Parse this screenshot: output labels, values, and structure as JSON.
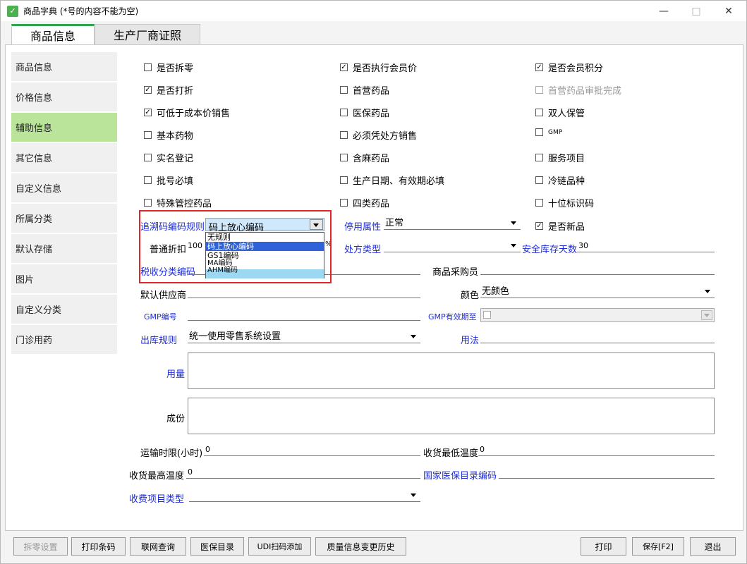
{
  "window": {
    "title": "商品字典 (*号的内容不能为空)",
    "minimize": "—",
    "maximize": "□",
    "close": "✕"
  },
  "tabs": [
    "商品信息",
    "生产厂商证照"
  ],
  "nav": [
    "商品信息",
    "价格信息",
    "辅助信息",
    "其它信息",
    "自定义信息",
    "所属分类",
    "默认存储",
    "图片",
    "自定义分类",
    "门诊用药"
  ],
  "checkboxes": {
    "col1": [
      {
        "label": "是否拆零",
        "checked": false
      },
      {
        "label": "是否打折",
        "checked": true
      },
      {
        "label": "可低于成本价销售",
        "checked": true
      },
      {
        "label": "基本药物",
        "checked": false
      },
      {
        "label": "实名登记",
        "checked": false
      },
      {
        "label": "批号必填",
        "checked": false
      },
      {
        "label": "特殊管控药品",
        "checked": false
      }
    ],
    "col2": [
      {
        "label": "是否执行会员价",
        "checked": true
      },
      {
        "label": "首营药品",
        "checked": false
      },
      {
        "label": "医保药品",
        "checked": false
      },
      {
        "label": "必须凭处方销售",
        "checked": false
      },
      {
        "label": "含麻药品",
        "checked": false
      },
      {
        "label": "生产日期、有效期必填",
        "checked": false
      },
      {
        "label": "四类药品",
        "checked": false
      }
    ],
    "col3": [
      {
        "label": "是否会员积分",
        "checked": true
      },
      {
        "label": "首营药品审批完成",
        "checked": false,
        "disabled": true
      },
      {
        "label": "双人保管",
        "checked": false
      },
      {
        "label": "GMP",
        "checked": false
      },
      {
        "label": "服务项目",
        "checked": false
      },
      {
        "label": "冷链品种",
        "checked": false
      },
      {
        "label": "十位标识码",
        "checked": false
      }
    ],
    "is_new": {
      "label": "是否新品",
      "checked": true
    }
  },
  "fields": {
    "trace_rule_label": "追溯码编码规则",
    "trace_rule_value": "码上放心编码",
    "trace_rule_options": [
      "无规则",
      "码上放心编码",
      "GS1编码",
      "MA编码",
      "AHM编码"
    ],
    "stop_attr_label": "停用属性",
    "stop_attr_value": "正常",
    "discount_label": "普通折扣",
    "discount_value": "100",
    "percent": "%",
    "rx_type_label": "处方类型",
    "safety_days_label": "安全库存天数",
    "safety_days_value": "30",
    "tax_code_label": "税收分类编码",
    "buyer_label": "商品采购员",
    "supplier_label": "默认供应商",
    "color_label": "颜色",
    "color_value": "无颜色",
    "gmp_no_label": "GMP编号",
    "gmp_expiry_label": "GMP有效期至",
    "outbound_label": "出库规则",
    "outbound_value": "统一使用零售系统设置",
    "usage_label": "用法",
    "dosage_label": "用量",
    "ingredient_label": "成份",
    "transport_label": "运输时限(小时)",
    "transport_value": "0",
    "min_temp_label": "收货最低温度",
    "min_temp_value": "0",
    "max_temp_label": "收货最高温度",
    "max_temp_value": "0",
    "insurance_code_label": "国家医保目录编码",
    "fee_type_label": "收费项目类型"
  },
  "buttons": {
    "split_setting": "拆零设置",
    "print_barcode": "打印条码",
    "online_query": "联网查询",
    "insurance_catalog": "医保目录",
    "udi_scan": "UDI扫码添加",
    "quality_history": "质量信息变更历史",
    "print": "打印",
    "save": "保存[F2]",
    "exit": "退出"
  },
  "colors": {
    "accent": "#2ea44f",
    "nav_active": "#b9e49a",
    "link_blue": "#1c2bdc",
    "highlight": "#e0242b"
  }
}
